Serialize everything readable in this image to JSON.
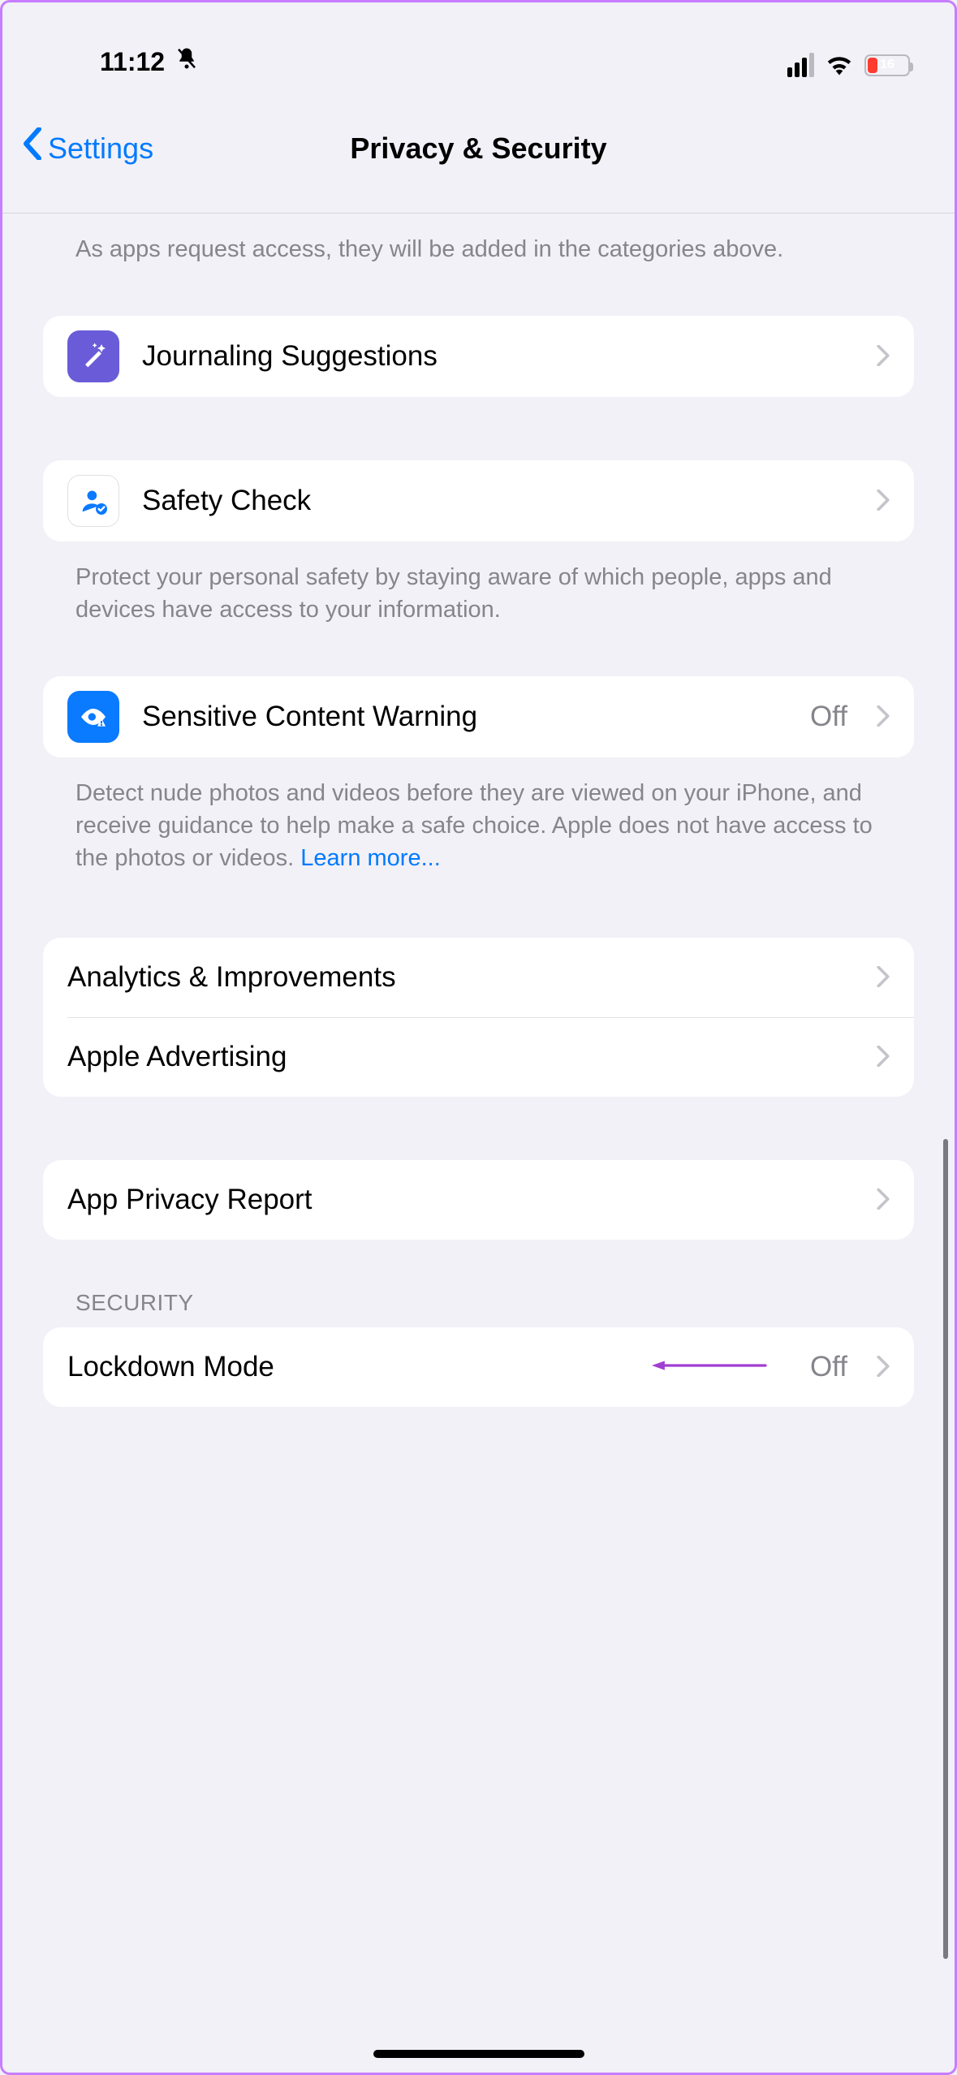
{
  "status": {
    "time": "11:12",
    "battery_pct": "16"
  },
  "nav": {
    "back_label": "Settings",
    "title": "Privacy & Security"
  },
  "top_footer": "As apps request access, they will be added in the categories above.",
  "rows": {
    "journaling": {
      "label": "Journaling Suggestions"
    },
    "safety_check": {
      "label": "Safety Check",
      "footer": "Protect your personal safety by staying aware of which people, apps and devices have access to your information."
    },
    "sensitive": {
      "label": "Sensitive Content Warning",
      "value": "Off",
      "footer_text": "Detect nude photos and videos before they are viewed on your iPhone, and receive guidance to help make a safe choice. Apple does not have access to the photos or videos. ",
      "footer_link": "Learn more..."
    },
    "analytics": {
      "label": "Analytics & Improvements"
    },
    "advertising": {
      "label": "Apple Advertising"
    },
    "privacy_report": {
      "label": "App Privacy Report"
    },
    "lockdown": {
      "label": "Lockdown Mode",
      "value": "Off"
    }
  },
  "section_security": "SECURITY",
  "colors": {
    "accent": "#007aff",
    "purple_icon": "#6a5cd8",
    "blue_icon": "#0a7aff",
    "annotation": "#a23dd1"
  }
}
